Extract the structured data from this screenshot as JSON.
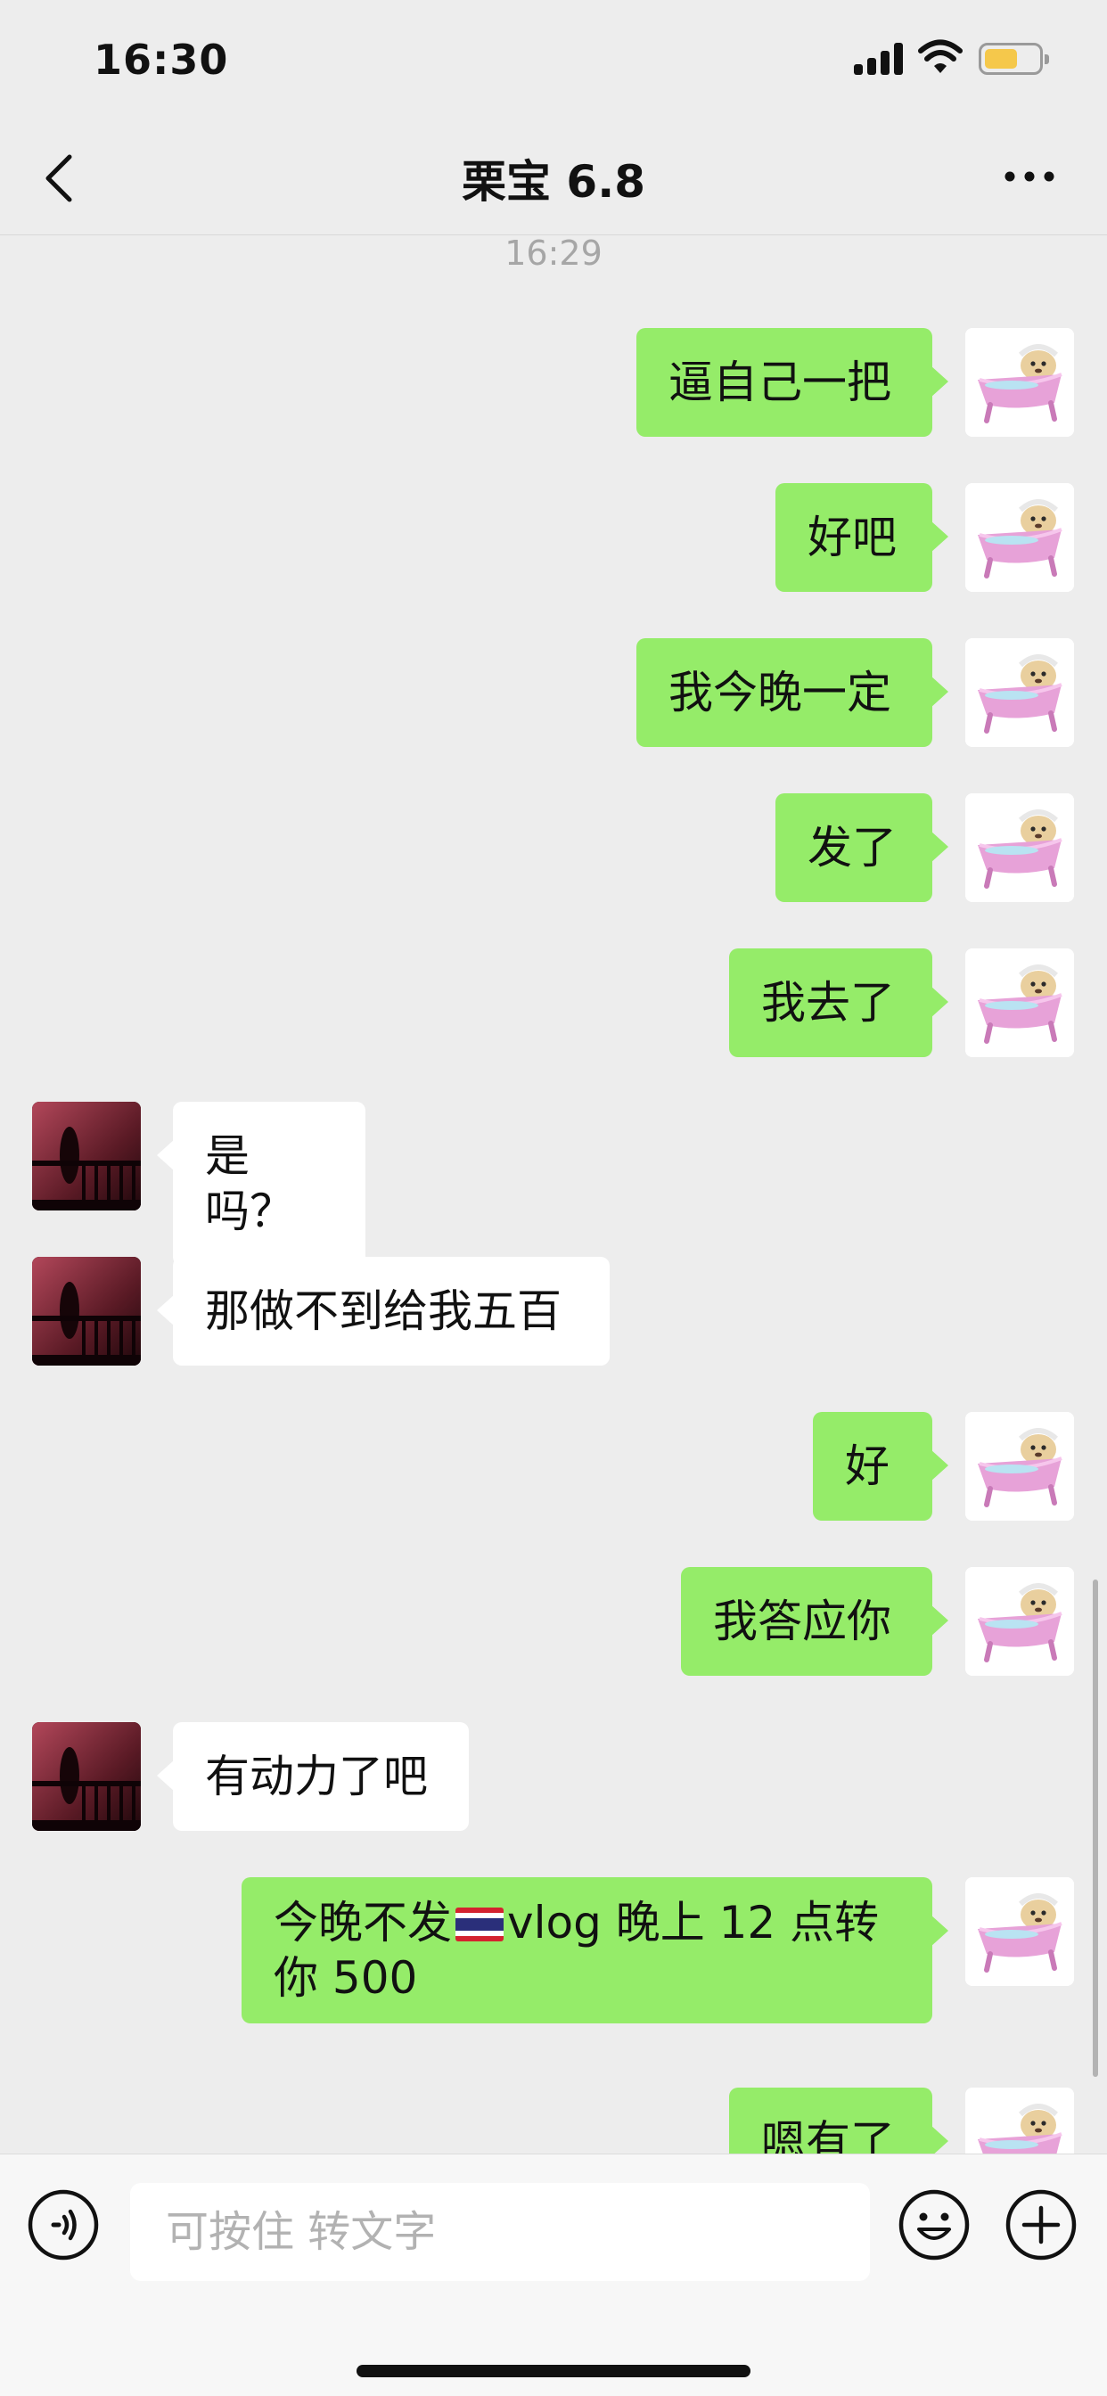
{
  "status_bar": {
    "time": "16:30",
    "battery_color": "#f5c84b"
  },
  "header": {
    "title": "栗宝 6.8",
    "back_icon": "chevron-left-icon",
    "more_icon": "more-dots-icon"
  },
  "timestamp": "16:29",
  "messages": [
    {
      "side": "me",
      "text": "逼自己一把"
    },
    {
      "side": "me",
      "text": "好吧"
    },
    {
      "side": "me",
      "text": "我今晚一定"
    },
    {
      "side": "me",
      "text": "发了"
    },
    {
      "side": "me",
      "text": "我去了"
    },
    {
      "side": "other",
      "text": "是吗？"
    },
    {
      "side": "other",
      "text": "那做不到给我五百"
    },
    {
      "side": "me",
      "text": "好"
    },
    {
      "side": "me",
      "text": "我答应你"
    },
    {
      "side": "other",
      "text": "有动力了吧"
    },
    {
      "side": "me",
      "text_before_flag": "今晚不发",
      "flag": "thailand-flag-icon",
      "text_after_flag": "vlog 晚上 12 点转你 500"
    },
    {
      "side": "me",
      "text": "嗯有了"
    }
  ],
  "input": {
    "placeholder": "可按住 转文字"
  },
  "colors": {
    "me_bubble": "#95ec69",
    "other_bubble": "#ffffff",
    "background": "#ededed"
  }
}
